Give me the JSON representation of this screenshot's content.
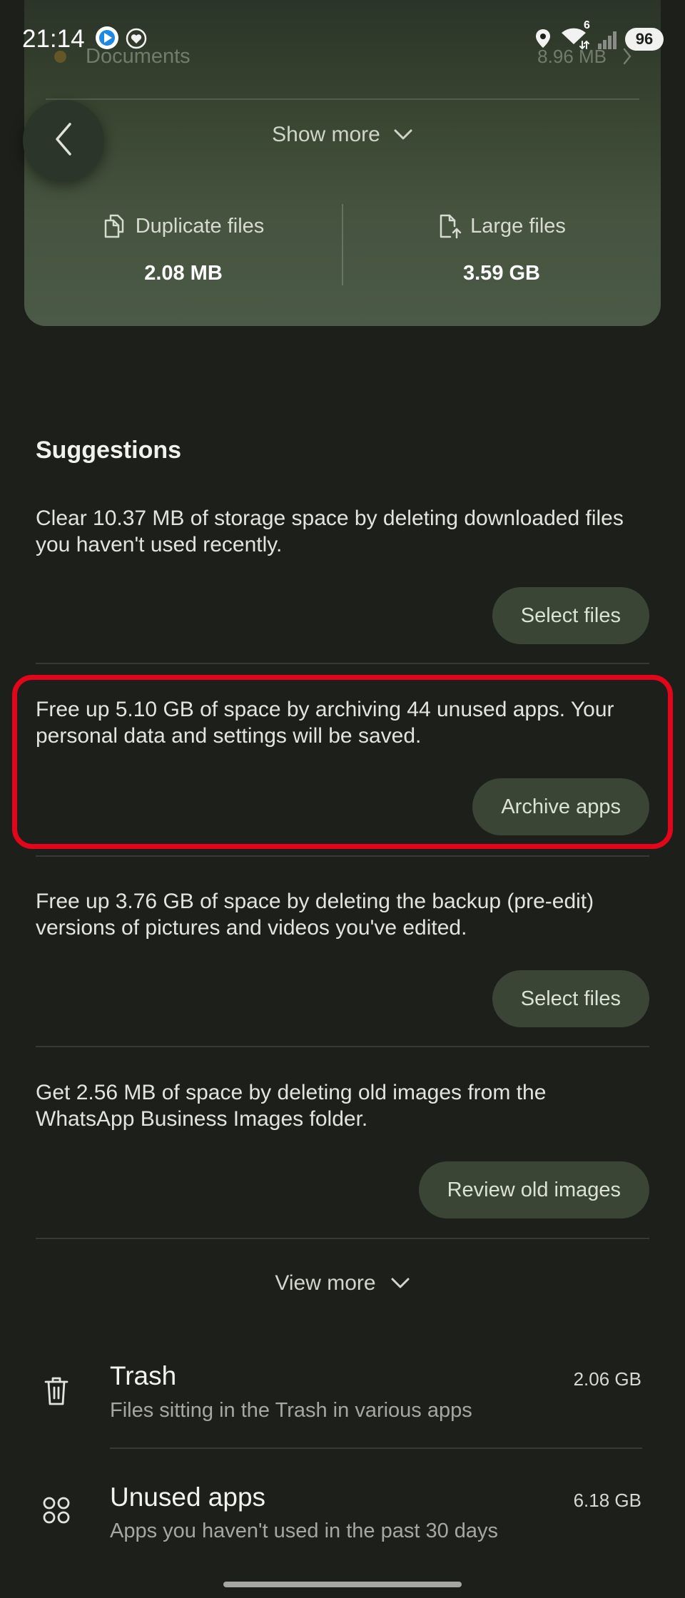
{
  "status_bar": {
    "time": "21:14",
    "wifi_label": "6",
    "battery_level": "96",
    "notification_icons": [
      "app-notification-icon",
      "heart-notification-icon"
    ],
    "system_icons": [
      "location-icon",
      "wifi-icon",
      "signal-icon",
      "battery-icon"
    ]
  },
  "storage_card": {
    "documents": {
      "label": "Documents",
      "size": "8.96 MB"
    },
    "show_more_label": "Show more",
    "duplicate_files": {
      "label": "Duplicate files",
      "value": "2.08 MB",
      "icon": "duplicate-files-icon"
    },
    "large_files": {
      "label": "Large files",
      "value": "3.59 GB",
      "icon": "large-files-icon"
    }
  },
  "suggestions": {
    "title": "Suggestions",
    "items": [
      {
        "text": "Clear 10.37 MB of storage space by deleting downloaded files you haven't used recently.",
        "button_label": "Select files"
      },
      {
        "text": "Free up 5.10 GB of space by archiving 44 unused apps. Your personal data and settings will be saved.",
        "button_label": "Archive apps"
      },
      {
        "text": "Free up 3.76 GB of space by deleting the backup (pre-edit) versions of pictures and videos you've edited.",
        "button_label": "Select files"
      },
      {
        "text": "Get 2.56 MB of space by deleting old images from the WhatsApp Business Images folder.",
        "button_label": "Review old images"
      }
    ],
    "view_more_label": "View more"
  },
  "categories": [
    {
      "title": "Trash",
      "subtitle": "Files sitting in the Trash in various apps",
      "size": "2.06 GB",
      "icon": "trash-icon"
    },
    {
      "title": "Unused apps",
      "subtitle": "Apps you haven't used in the past 30 days",
      "size": "6.18 GB",
      "icon": "unused-apps-icon"
    }
  ],
  "colors": {
    "background": "#1d1f1a",
    "card_top": "#2b3428",
    "card_bottom": "#4b5a46",
    "button_background": "#3a4535",
    "highlight_border": "#e3061b",
    "documents_dot": "#8c6b25"
  }
}
